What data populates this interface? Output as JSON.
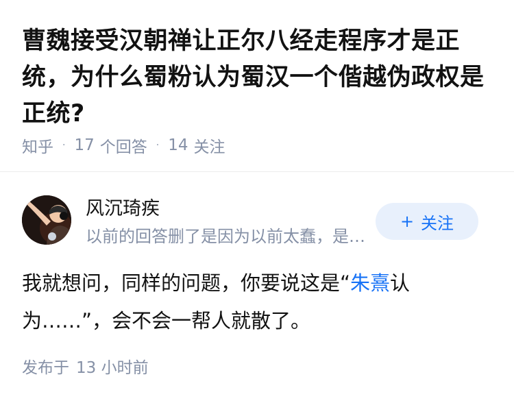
{
  "question": {
    "title": "曹魏接受汉朝禅让正尔八经走程序才是正统，为什么蜀粉认为蜀汉一个偕越伪政权是正统?",
    "source": "知乎",
    "answer_count": "17",
    "answer_label": "个回答",
    "follower_count": "14",
    "follower_label": "关注",
    "separator": "·"
  },
  "answer": {
    "author": {
      "name": "风沉琦疾",
      "bio": "以前的回答删了是因为以前太蠢，是我的黑历史",
      "avatar_icon": "user-avatar-photo"
    },
    "follow_button": {
      "icon": "plus-icon",
      "plus": "+",
      "label": "关注"
    },
    "content": {
      "before_link": "我就想问，同样的问题，你要说这是“",
      "link_text": "朱熹",
      "after_link": "认为……”，会不会一帮人就散了。"
    },
    "published": {
      "label": "发布于",
      "time": "13 小时前"
    }
  },
  "colors": {
    "text_primary": "#121212",
    "text_secondary": "#8590a6",
    "accent_blue": "#1772f6",
    "follow_button_bg": "#e8f0fc",
    "divider": "#ececec"
  }
}
